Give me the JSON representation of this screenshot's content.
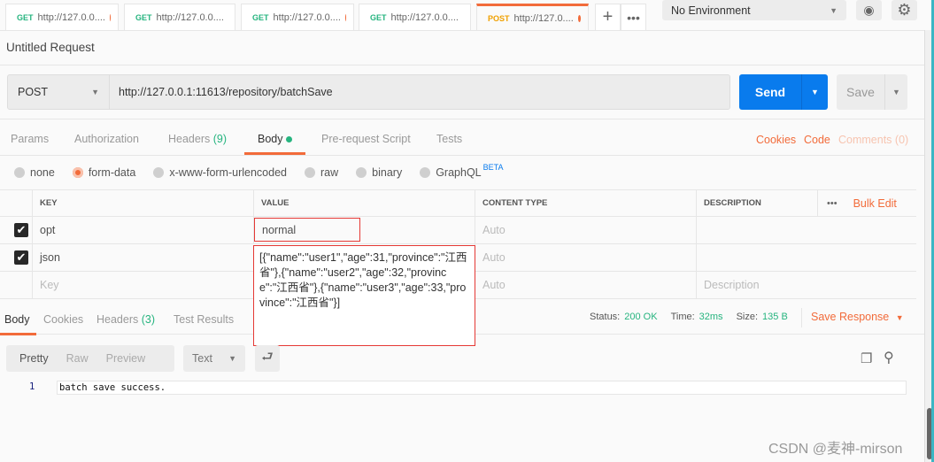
{
  "tabs": [
    {
      "method": "GET",
      "label": "http://127.0.0...."
    },
    {
      "method": "GET",
      "label": "http://127.0.0...."
    },
    {
      "method": "GET",
      "label": "http://127.0.0...."
    },
    {
      "method": "GET",
      "label": "http://127.0.0...."
    },
    {
      "method": "POST",
      "label": "http://127.0...."
    }
  ],
  "environment": "No Environment",
  "request_title": "Untitled Request",
  "method": "POST",
  "url": "http://127.0.0.1:11613/repository/batchSave",
  "send_label": "Send",
  "save_label": "Save",
  "req_tabs": {
    "params": "Params",
    "auth": "Authorization",
    "headers": "Headers",
    "headers_count": "(9)",
    "body": "Body",
    "prereq": "Pre-request Script",
    "tests": "Tests"
  },
  "links": {
    "cookies": "Cookies",
    "code": "Code",
    "comments": "Comments (0)"
  },
  "body_types": [
    "none",
    "form-data",
    "x-www-form-urlencoded",
    "raw",
    "binary",
    "GraphQL"
  ],
  "beta": "BETA",
  "table": {
    "headers": {
      "key": "KEY",
      "value": "VALUE",
      "content_type": "CONTENT TYPE",
      "description": "DESCRIPTION",
      "bulk_edit": "Bulk Edit"
    },
    "rows": [
      {
        "key": "opt",
        "value": "normal",
        "content_type": "Auto"
      },
      {
        "key": "json",
        "value": "[{\"name\":\"user1\",\"age\":31,\"province\":\"江西省\"},{\"name\":\"user2\",\"age\":32,\"province\":\"江西省\"},{\"name\":\"user3\",\"age\":33,\"province\":\"江西省\"}]",
        "content_type": "Auto"
      }
    ],
    "placeholder": {
      "key": "Key",
      "content_type": "Auto",
      "description": "Description"
    }
  },
  "resp_tabs": {
    "body": "Body",
    "cookies": "Cookies",
    "headers": "Headers",
    "headers_count": "(3)",
    "tests": "Test Results"
  },
  "status": {
    "status_label": "Status:",
    "status": "200 OK",
    "time_label": "Time:",
    "time": "32ms",
    "size_label": "Size:",
    "size": "135 B"
  },
  "save_response": "Save Response",
  "view": {
    "pretty": "Pretty",
    "raw": "Raw",
    "preview": "Preview",
    "format": "Text"
  },
  "response": {
    "line": "1",
    "text": "batch save success."
  },
  "watermark": "CSDN @麦神-mirson"
}
